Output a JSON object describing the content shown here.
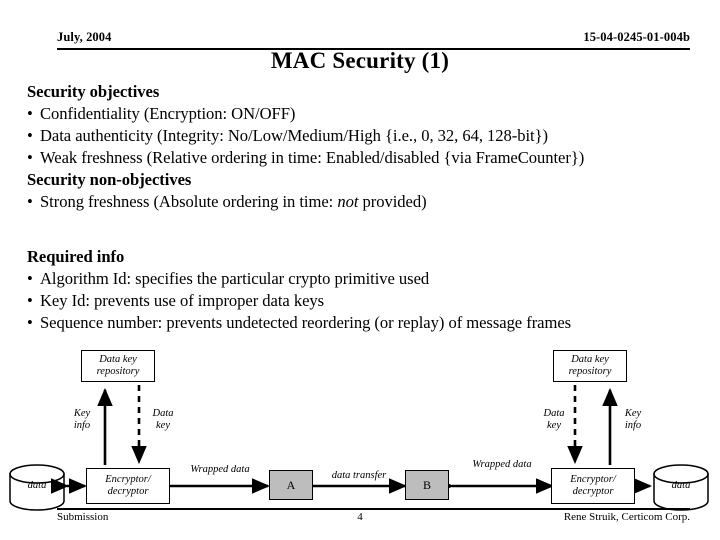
{
  "header": {
    "date": "July, 2004",
    "doc_number": "15-04-0245-01-004b"
  },
  "title": "MAC Security (1)",
  "sections": [
    {
      "heading": "Security objectives",
      "bullets": [
        "Confidentiality (Encryption: ON/OFF)",
        "Data authenticity (Integrity: No/Low/Medium/High {i.e.,  0, 32, 64, 128-bit})",
        "Weak freshness (Relative ordering in time: Enabled/disabled {via FrameCounter})"
      ]
    },
    {
      "heading": "Security non-objectives",
      "bullets_rich": [
        {
          "pre": "Strong freshness (Absolute ordering in time: ",
          "italic": "not",
          "post": " provided)"
        }
      ]
    },
    {
      "heading": "Required info",
      "bullets": [
        "Algorithm Id: specifies the particular crypto primitive used",
        "Key Id: prevents use of improper data keys",
        "Sequence number: prevents undetected reordering (or replay) of message frames"
      ]
    }
  ],
  "diagram": {
    "left": {
      "repository_label": "Data key\nrepository",
      "repository_line1": "Data key",
      "repository_line2": "repository",
      "up_arrow_label_line1": "Key",
      "up_arrow_label_line2": "info",
      "down_arrow_label_line1": "Data",
      "down_arrow_label_line2": "key",
      "store_label": "data",
      "engine_line1": "Encryptor/",
      "engine_line2": "decryptor",
      "wrapped_label": "Wrapped data",
      "endpoint_label": "A"
    },
    "center": {
      "transfer_label": "data transfer"
    },
    "right": {
      "repository_line1": "Data key",
      "repository_line2": "repository",
      "down_arrow_label_line1": "Data",
      "down_arrow_label_line2": "key",
      "up_arrow_label_line1": "Key",
      "up_arrow_label_line2": "info",
      "store_label": "data",
      "engine_line1": "Encryptor/",
      "engine_line2": "decryptor",
      "wrapped_label": "Wrapped data",
      "endpoint_label": "B"
    },
    "colors": {
      "endpoint_fill": "#bdbdbd",
      "stroke": "#000000",
      "background": "#ffffff"
    }
  },
  "footer": {
    "left": "Submission",
    "page": "4",
    "right": "Rene Struik, Certicom Corp."
  }
}
